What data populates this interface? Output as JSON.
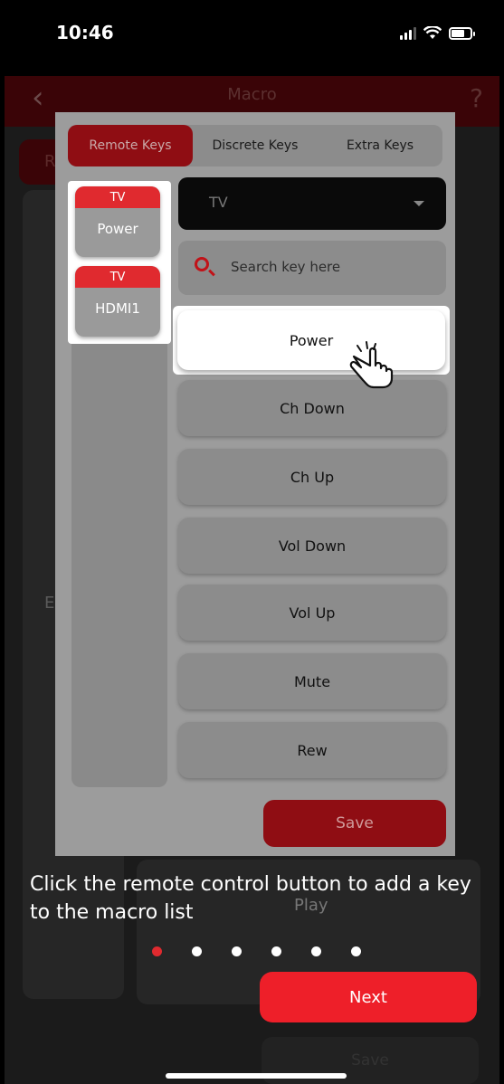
{
  "status": {
    "time": "10:46"
  },
  "appbar": {
    "title": "Macro",
    "help": "?"
  },
  "background": {
    "partial_tab": "R",
    "partial_label": "E",
    "play_label": "Play",
    "save_label": "Save"
  },
  "modal": {
    "tabs": [
      {
        "label": "Remote Keys",
        "active": true
      },
      {
        "label": "Discrete Keys",
        "active": false
      },
      {
        "label": "Extra Keys",
        "active": false
      }
    ],
    "added_keys": [
      {
        "device": "TV",
        "name": "Power"
      },
      {
        "device": "TV",
        "name": "HDMI1"
      }
    ],
    "device_select": {
      "value": "TV"
    },
    "search": {
      "placeholder": "Search key here"
    },
    "keys": [
      "Power",
      "Ch Down",
      "Ch Up",
      "Vol Down",
      "Vol Up",
      "Mute",
      "Rew"
    ],
    "save_label": "Save"
  },
  "tutorial": {
    "hint": "Click the remote control button to add a key to the macro list",
    "pages": 6,
    "current_page": 1,
    "next_label": "Next"
  },
  "colors": {
    "accent": "#ee1f29",
    "dark_accent": "#8f0d13"
  }
}
